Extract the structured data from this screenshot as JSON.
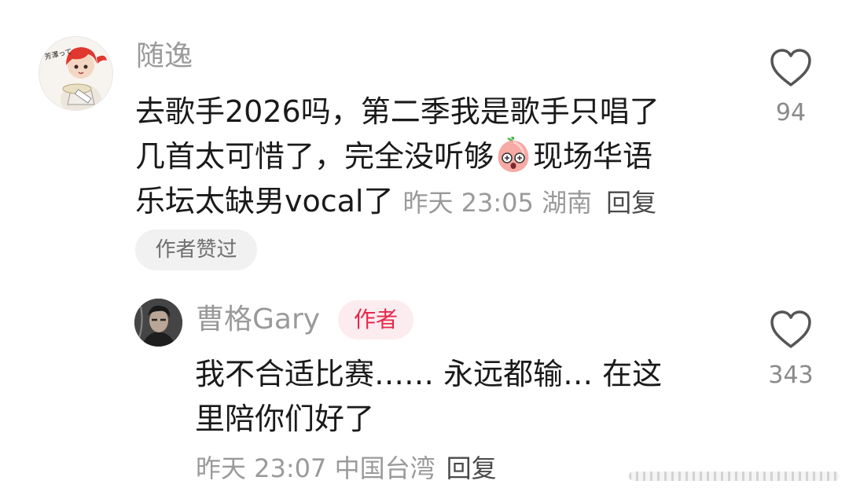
{
  "comments": [
    {
      "username": "随逸",
      "text_lines": [
        "去歌手2026吗，第二季我是歌手只唱了",
        "几首太可惜了，完全没听够",
        "现场华语",
        "乐坛太缺男vocal了"
      ],
      "time": "昨天 23:05",
      "location": "湖南",
      "reply_label": "回复",
      "author_liked_label": "作者赞过",
      "like_count": "94",
      "avatar_text": "芳澤って",
      "emoji": "peach-shocked-emoji"
    },
    {
      "username": "曹格Gary",
      "author_tag": "作者",
      "text_lines": [
        "我不合适比赛…… 永远都输… 在这",
        "里陪你们好了"
      ],
      "time": "昨天 23:07",
      "location": "中国台湾",
      "reply_label": "回复",
      "like_count": "343"
    }
  ],
  "colors": {
    "muted": "#9a9a9a",
    "text": "#1a1a1a",
    "author_tag_bg": "#fdecef",
    "author_tag_fg": "#e6284c"
  }
}
